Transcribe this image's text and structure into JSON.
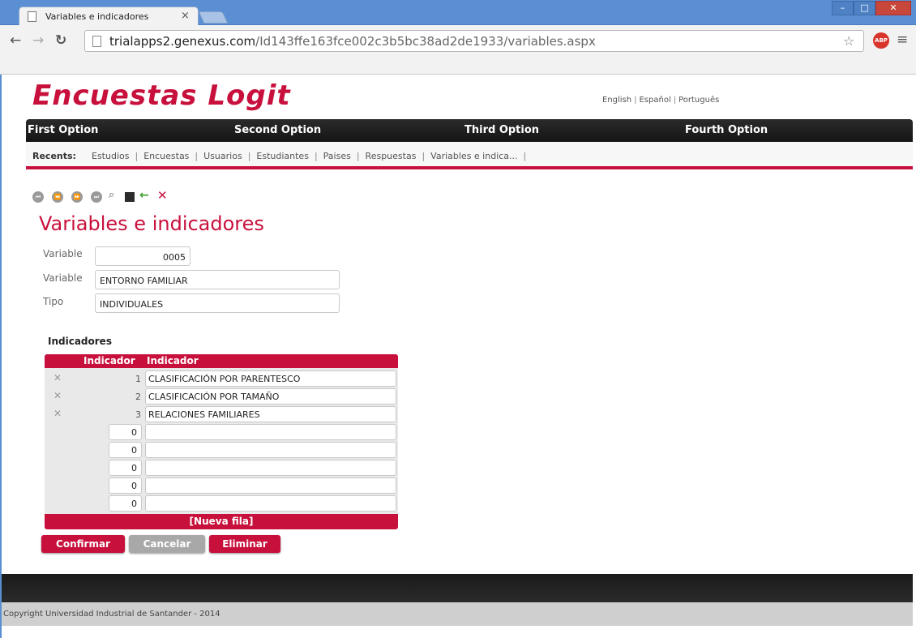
{
  "browser": {
    "tab_title": "Variables e indicadores",
    "tab_close": "×",
    "url_host": "trialapps2.genexus.com",
    "url_path": "/Id143ffe163fce002c3b5bc38ad2de1933/variables.aspx",
    "abp_label": "ABP",
    "icons": [
      "back-arrow-icon",
      "forward-arrow-icon",
      "reload-icon",
      "page-icon",
      "star-icon",
      "menu-icon"
    ]
  },
  "header": {
    "brand": "Encuestas Logit",
    "languages": [
      "English",
      "Español",
      "Português"
    ]
  },
  "nav": {
    "items": [
      "First Option",
      "Second Option",
      "Third Option",
      "Fourth Option"
    ]
  },
  "recents": {
    "label": "Recents:",
    "items": [
      "Estudios",
      "Encuestas",
      "Usuarios",
      "Estudiantes",
      "Paises",
      "Respuestas",
      "Variables e indica..."
    ]
  },
  "page": {
    "title": "Variables e indicadores",
    "fields": {
      "variable_id_label": "Variable",
      "variable_id_value": "0005",
      "variable_name_label": "Variable",
      "variable_name_value": "ENTORNO FAMILIAR",
      "tipo_label": "Tipo",
      "tipo_value": "INDIVIDUALES"
    }
  },
  "grid": {
    "section_title": "Indicadores",
    "headers": [
      "Indicador",
      "Indicador"
    ],
    "rows": [
      {
        "id": "1",
        "name": "CLASIFICACIÓN POR PARENTESCO"
      },
      {
        "id": "2",
        "name": "CLASIFICACIÓN POR TAMAÑO"
      },
      {
        "id": "3",
        "name": "RELACIONES FAMILIARES"
      }
    ],
    "empty_rows": [
      {
        "id": "0"
      },
      {
        "id": "0"
      },
      {
        "id": "0"
      },
      {
        "id": "0"
      },
      {
        "id": "0"
      }
    ],
    "new_row_label": "[Nueva fila]"
  },
  "actions": {
    "confirm": "Confirmar",
    "cancel": "Cancelar",
    "delete": "Eliminar"
  },
  "footer": {
    "copyright": "Copyright Universidad Industrial de Santander - 2014"
  },
  "colors": {
    "brand": "#c8103c",
    "nav_bg": "#1f1f1f",
    "chrome_blue": "#5b8fd3"
  }
}
